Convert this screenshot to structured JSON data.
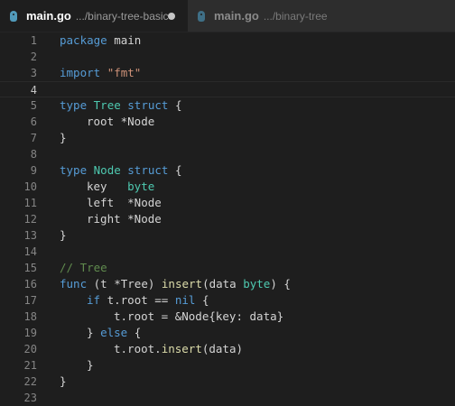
{
  "tabs": [
    {
      "name": "main.go",
      "path": ".../binary-tree-basic",
      "dirty": true,
      "active": true
    },
    {
      "name": "main.go",
      "path": ".../binary-tree",
      "dirty": false,
      "active": false
    }
  ],
  "current_line": 4,
  "lines": [
    {
      "n": "1",
      "indent": 0,
      "tokens": [
        [
          "kw",
          "package"
        ],
        [
          "tx",
          " main"
        ]
      ]
    },
    {
      "n": "2",
      "indent": 0,
      "tokens": []
    },
    {
      "n": "3",
      "indent": 0,
      "tokens": [
        [
          "kw",
          "import"
        ],
        [
          "tx",
          " "
        ],
        [
          "st",
          "\"fmt\""
        ]
      ]
    },
    {
      "n": "4",
      "indent": 0,
      "tokens": []
    },
    {
      "n": "5",
      "indent": 0,
      "tokens": [
        [
          "kw",
          "type"
        ],
        [
          "tx",
          " "
        ],
        [
          "ty",
          "Tree"
        ],
        [
          "tx",
          " "
        ],
        [
          "kw",
          "struct"
        ],
        [
          "tx",
          " {"
        ]
      ]
    },
    {
      "n": "6",
      "indent": 1,
      "tokens": [
        [
          "tx",
          "root *Node"
        ]
      ]
    },
    {
      "n": "7",
      "indent": 0,
      "tokens": [
        [
          "tx",
          "}"
        ]
      ]
    },
    {
      "n": "8",
      "indent": 0,
      "tokens": []
    },
    {
      "n": "9",
      "indent": 0,
      "tokens": [
        [
          "kw",
          "type"
        ],
        [
          "tx",
          " "
        ],
        [
          "ty",
          "Node"
        ],
        [
          "tx",
          " "
        ],
        [
          "kw",
          "struct"
        ],
        [
          "tx",
          " {"
        ]
      ]
    },
    {
      "n": "10",
      "indent": 1,
      "tokens": [
        [
          "tx",
          "key   "
        ],
        [
          "ty",
          "byte"
        ]
      ]
    },
    {
      "n": "11",
      "indent": 1,
      "tokens": [
        [
          "tx",
          "left  *Node"
        ]
      ]
    },
    {
      "n": "12",
      "indent": 1,
      "tokens": [
        [
          "tx",
          "right *Node"
        ]
      ]
    },
    {
      "n": "13",
      "indent": 0,
      "tokens": [
        [
          "tx",
          "}"
        ]
      ]
    },
    {
      "n": "14",
      "indent": 0,
      "tokens": []
    },
    {
      "n": "15",
      "indent": 0,
      "tokens": [
        [
          "cm",
          "// Tree"
        ]
      ]
    },
    {
      "n": "16",
      "indent": 0,
      "tokens": [
        [
          "kw",
          "func"
        ],
        [
          "tx",
          " (t *Tree) "
        ],
        [
          "fn",
          "insert"
        ],
        [
          "tx",
          "(data "
        ],
        [
          "ty",
          "byte"
        ],
        [
          "tx",
          ") {"
        ]
      ]
    },
    {
      "n": "17",
      "indent": 1,
      "tokens": [
        [
          "kw",
          "if"
        ],
        [
          "tx",
          " t.root == "
        ],
        [
          "kw",
          "nil"
        ],
        [
          "tx",
          " {"
        ]
      ]
    },
    {
      "n": "18",
      "indent": 2,
      "tokens": [
        [
          "tx",
          "t.root = &Node{key: data}"
        ]
      ]
    },
    {
      "n": "19",
      "indent": 1,
      "tokens": [
        [
          "tx",
          "} "
        ],
        [
          "kw",
          "else"
        ],
        [
          "tx",
          " {"
        ]
      ]
    },
    {
      "n": "20",
      "indent": 2,
      "tokens": [
        [
          "tx",
          "t.root."
        ],
        [
          "fn",
          "insert"
        ],
        [
          "tx",
          "(data)"
        ]
      ]
    },
    {
      "n": "21",
      "indent": 1,
      "tokens": [
        [
          "tx",
          "}"
        ]
      ]
    },
    {
      "n": "22",
      "indent": 0,
      "tokens": [
        [
          "tx",
          "}"
        ]
      ]
    },
    {
      "n": "23",
      "indent": 0,
      "tokens": []
    }
  ]
}
